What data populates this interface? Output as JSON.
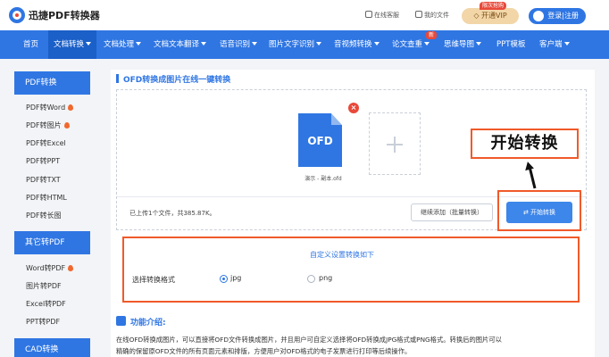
{
  "header": {
    "logo_text": "迅捷PDF转换器",
    "service_label": "在线客服",
    "files_label": "我的文件",
    "vip_label": "开通VIP",
    "vip_tag": "限次抢购",
    "login_label": "登录|注册"
  },
  "nav": {
    "items": [
      {
        "label": "首页",
        "has_caret": false
      },
      {
        "label": "文档转换",
        "has_caret": true
      },
      {
        "label": "文档处理",
        "has_caret": true
      },
      {
        "label": "文档文本翻译",
        "has_caret": true
      },
      {
        "label": "语音识别",
        "has_caret": true
      },
      {
        "label": "图片文字识别",
        "has_caret": true
      },
      {
        "label": "音视频转换",
        "has_caret": true
      },
      {
        "label": "论文查重",
        "has_caret": true
      },
      {
        "label": "思维导图",
        "has_caret": true
      },
      {
        "label": "PPT模板",
        "has_caret": false
      },
      {
        "label": "客户端",
        "has_caret": true
      }
    ],
    "new_badge": "新",
    "active_index": 1
  },
  "sidebar": {
    "section1_title": "PDF转换",
    "section1_items": [
      {
        "label": "PDF转Word",
        "hot": true
      },
      {
        "label": "PDF转图片",
        "hot": true
      },
      {
        "label": "PDF转Excel",
        "hot": false
      },
      {
        "label": "PDF转PPT",
        "hot": false
      },
      {
        "label": "PDF转TXT",
        "hot": false
      },
      {
        "label": "PDF转HTML",
        "hot": false
      },
      {
        "label": "PDF转长图",
        "hot": false
      }
    ],
    "section2_title": "其它转PDF",
    "section2_items": [
      {
        "label": "Word转PDF",
        "hot": true
      },
      {
        "label": "图片转PDF",
        "hot": false
      },
      {
        "label": "Excel转PDF",
        "hot": false
      },
      {
        "label": "PPT转PDF",
        "hot": false
      }
    ],
    "section3_title": "CAD转换"
  },
  "main": {
    "title": "OFD转换成图片在线一键转换",
    "file_badge": "OFD",
    "file_name": "演示 - 副本.ofd",
    "status_text": "已上传1个文件，共385.87K。",
    "continue_button": "继续添加（批量转换）",
    "start_button": "开始转换",
    "callout_text": "开始转换"
  },
  "settings": {
    "tip": "自定义设置转换如下",
    "label": "选择转换格式",
    "options": [
      {
        "label": "jpg",
        "selected": true
      },
      {
        "label": "png",
        "selected": false
      }
    ]
  },
  "intro": {
    "title": "功能介绍:",
    "line1": "在线OFD转换成图片，可以直接将OFD文件转换成图片，并且用户可自定义选择将OFD转换成JPG格式或PNG格式。转换后的图片可以",
    "line2": "精确的保留原OFD文件的所有页面元素和排版，方便用户对OFD格式的电子发票进行打印等后续操作。"
  },
  "colors": {
    "brand": "#2f76e3",
    "highlight": "#f05a2a",
    "hot": "#f0682e",
    "danger": "#e8493a"
  }
}
